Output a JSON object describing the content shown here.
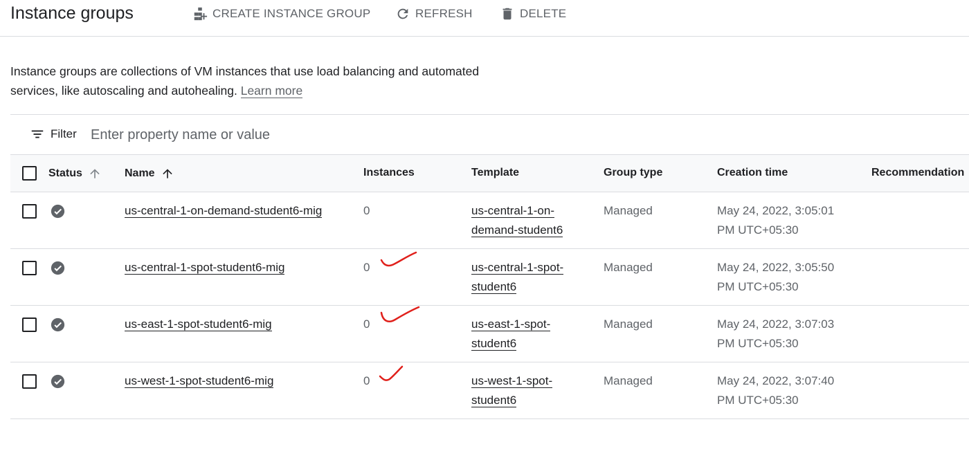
{
  "header": {
    "title": "Instance groups",
    "create_label": "CREATE INSTANCE GROUP",
    "refresh_label": "REFRESH",
    "delete_label": "DELETE"
  },
  "description": {
    "text": "Instance groups are collections of VM instances that use load balancing and automated services, like autoscaling and autohealing.",
    "learn_more": "Learn more"
  },
  "filter": {
    "label": "Filter",
    "placeholder": "Enter property name or value"
  },
  "table": {
    "columns": {
      "status": "Status",
      "name": "Name",
      "instances": "Instances",
      "template": "Template",
      "group_type": "Group type",
      "creation_time": "Creation time",
      "recommendation": "Recommendation"
    },
    "rows": [
      {
        "name": "us-central-1-on-demand-student6-mig",
        "instances": "0",
        "template_line1": "us-central-1-on-",
        "template_line2": "demand-student6",
        "group_type": "Managed",
        "time_line1": "May 24, 2022, 3:05:01",
        "time_line2": "PM UTC+05:30",
        "status_icon": "check-circle-icon",
        "annotated": false
      },
      {
        "name": "us-central-1-spot-student6-mig",
        "instances": "0",
        "template_line1": "us-central-1-spot-",
        "template_line2": "student6",
        "group_type": "Managed",
        "time_line1": "May 24, 2022, 3:05:50",
        "time_line2": "PM UTC+05:30",
        "status_icon": "check-circle-icon",
        "annotated": true
      },
      {
        "name": "us-east-1-spot-student6-mig",
        "instances": "0",
        "template_line1": "us-east-1-spot-",
        "template_line2": "student6",
        "group_type": "Managed",
        "time_line1": "May 24, 2022, 3:07:03",
        "time_line2": "PM UTC+05:30",
        "status_icon": "check-circle-icon",
        "annotated": true
      },
      {
        "name": "us-west-1-spot-student6-mig",
        "instances": "0",
        "template_line1": "us-west-1-spot-",
        "template_line2": "student6",
        "group_type": "Managed",
        "time_line1": "May 24, 2022, 3:07:40",
        "time_line2": "PM UTC+05:30",
        "status_icon": "check-circle-icon",
        "annotated": true
      }
    ]
  },
  "colors": {
    "text": "#202124",
    "muted": "#5f6368",
    "border": "#dadce0",
    "header_bg": "#f8f9fa",
    "status_icon": "#5f6368",
    "annotation": "#e0201b"
  }
}
